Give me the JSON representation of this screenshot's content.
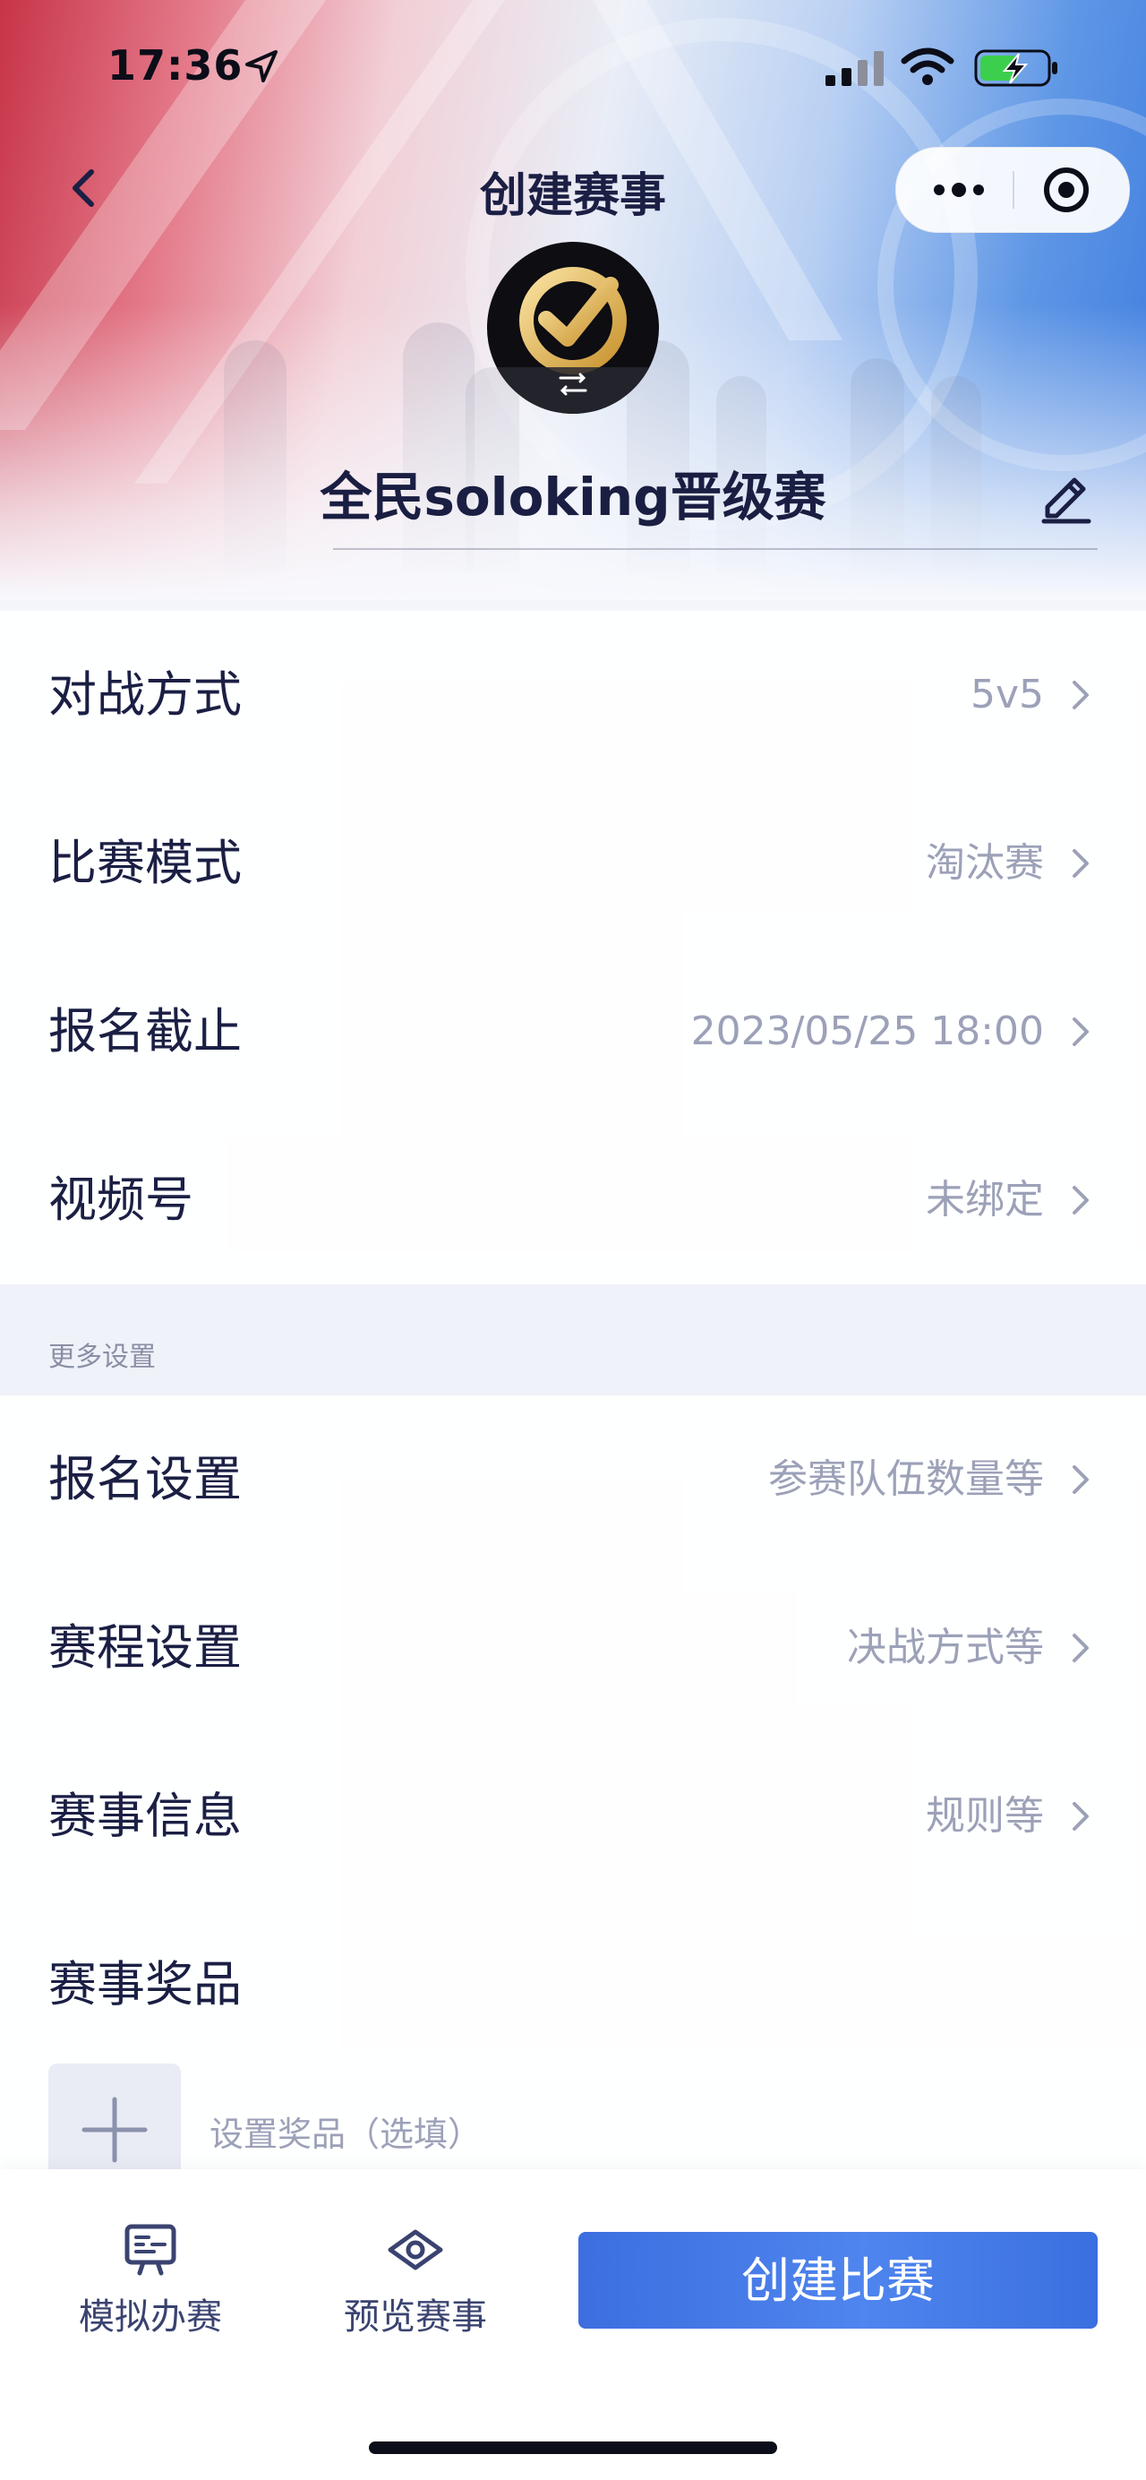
{
  "status_bar": {
    "time": "17:36"
  },
  "nav": {
    "title": "创建赛事"
  },
  "tournament": {
    "name": "全民soloking晋级赛"
  },
  "settings": [
    {
      "label": "对战方式",
      "value": "5v5"
    },
    {
      "label": "比赛模式",
      "value": "淘汰赛"
    },
    {
      "label": "报名截止",
      "value": "2023/05/25 18:00"
    },
    {
      "label": "视频号",
      "value": "未绑定"
    }
  ],
  "more_settings": {
    "header": "更多设置",
    "items": [
      {
        "label": "报名设置",
        "value": "参赛队伍数量等"
      },
      {
        "label": "赛程设置",
        "value": "决战方式等"
      },
      {
        "label": "赛事信息",
        "value": "规则等"
      }
    ]
  },
  "prize": {
    "label": "赛事奖品",
    "placeholder": "设置奖品（选填）"
  },
  "bottom_bar": {
    "simulate_label": "模拟办赛",
    "preview_label": "预览赛事",
    "create_label": "创建比赛"
  },
  "colors": {
    "accent": "#4a7fe8",
    "text_primary": "#1b1f44",
    "text_secondary": "#9ca1b8"
  },
  "icons": [
    "location-arrow-icon",
    "signal-icon",
    "wifi-icon",
    "battery-charging-icon",
    "back-chevron-icon",
    "more-dots-icon",
    "target-icon",
    "edit-pencil-icon",
    "chevron-right-icon",
    "plus-icon",
    "simulate-board-icon",
    "eye-icon"
  ]
}
